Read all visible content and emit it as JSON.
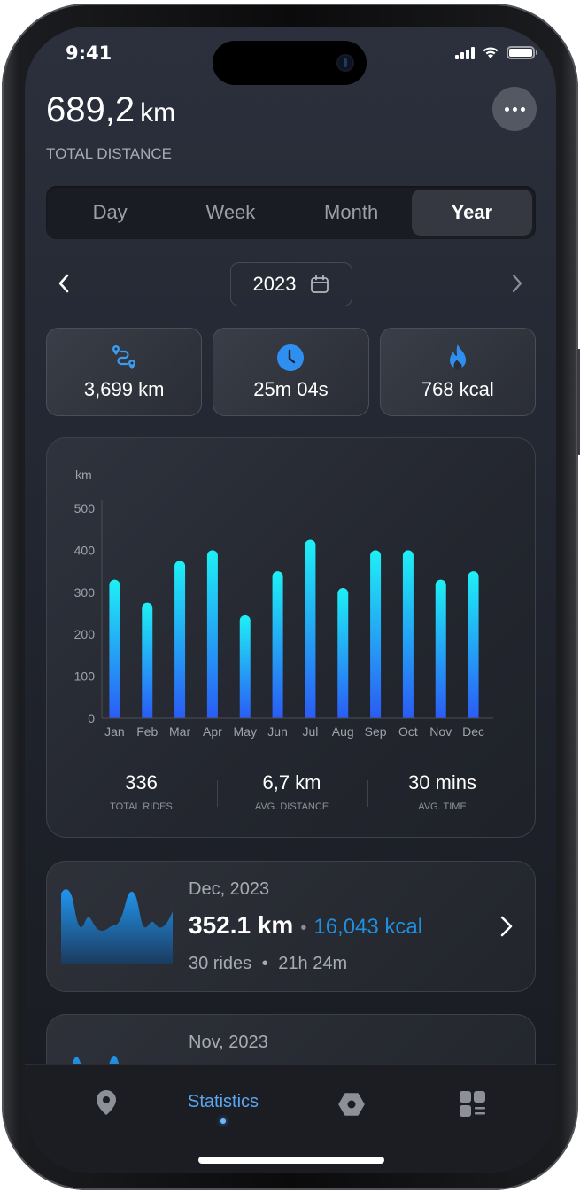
{
  "status_bar": {
    "time": "9:41"
  },
  "header": {
    "total_value": "689,2",
    "total_unit": "km",
    "total_label": "TOTAL DISTANCE",
    "more_icon": "more-horizontal-icon"
  },
  "segments": [
    {
      "label": "Day",
      "active": false
    },
    {
      "label": "Week",
      "active": false
    },
    {
      "label": "Month",
      "active": false
    },
    {
      "label": "Year",
      "active": true
    }
  ],
  "date_nav": {
    "year": "2023",
    "prev_icon": "chevron-left-icon",
    "next_icon": "chevron-right-icon",
    "calendar_icon": "calendar-icon"
  },
  "stat_cards": [
    {
      "icon": "route-icon",
      "value": "3,699 km"
    },
    {
      "icon": "clock-icon",
      "value": "25m 04s"
    },
    {
      "icon": "flame-icon",
      "value": "768 kcal"
    }
  ],
  "colors": {
    "accent": "#2f8ff0",
    "bar_top": "#1ef0f5",
    "bar_bottom": "#2a5cf5",
    "kcal": "#1f8fe0",
    "active_tab": "#5aa6f0"
  },
  "chart_data": {
    "type": "bar",
    "ylabel": "km",
    "xlabel": "",
    "title": "",
    "categories": [
      "Jan",
      "Feb",
      "Mar",
      "Apr",
      "May",
      "Jun",
      "Jul",
      "Aug",
      "Sep",
      "Oct",
      "Nov",
      "Dec"
    ],
    "values": [
      330,
      275,
      375,
      400,
      245,
      350,
      425,
      310,
      400,
      400,
      330,
      350
    ],
    "ylim": [
      0,
      500
    ],
    "yticks": [
      0,
      100,
      200,
      300,
      400,
      500
    ],
    "grid": false,
    "legend": "none"
  },
  "summary": [
    {
      "value": "336",
      "label": "TOTAL RIDES"
    },
    {
      "value": "6,7 km",
      "label": "AVG. DISTANCE"
    },
    {
      "value": "30 mins",
      "label": "AVG. TIME"
    }
  ],
  "months": [
    {
      "date": "Dec, 2023",
      "distance": "352.1 km",
      "separator": "•",
      "kcal": "16,043 kcal",
      "rides": "30 rides",
      "sub_separator": "•",
      "duration": "21h 24m"
    },
    {
      "date": "Nov, 2023"
    }
  ],
  "tabbar": {
    "items": [
      {
        "icon": "map-pin-icon",
        "label": ""
      },
      {
        "icon": "",
        "label": "Statistics",
        "active": true
      },
      {
        "icon": "hex-nut-icon",
        "label": ""
      },
      {
        "icon": "dashboard-icon",
        "label": ""
      }
    ]
  }
}
